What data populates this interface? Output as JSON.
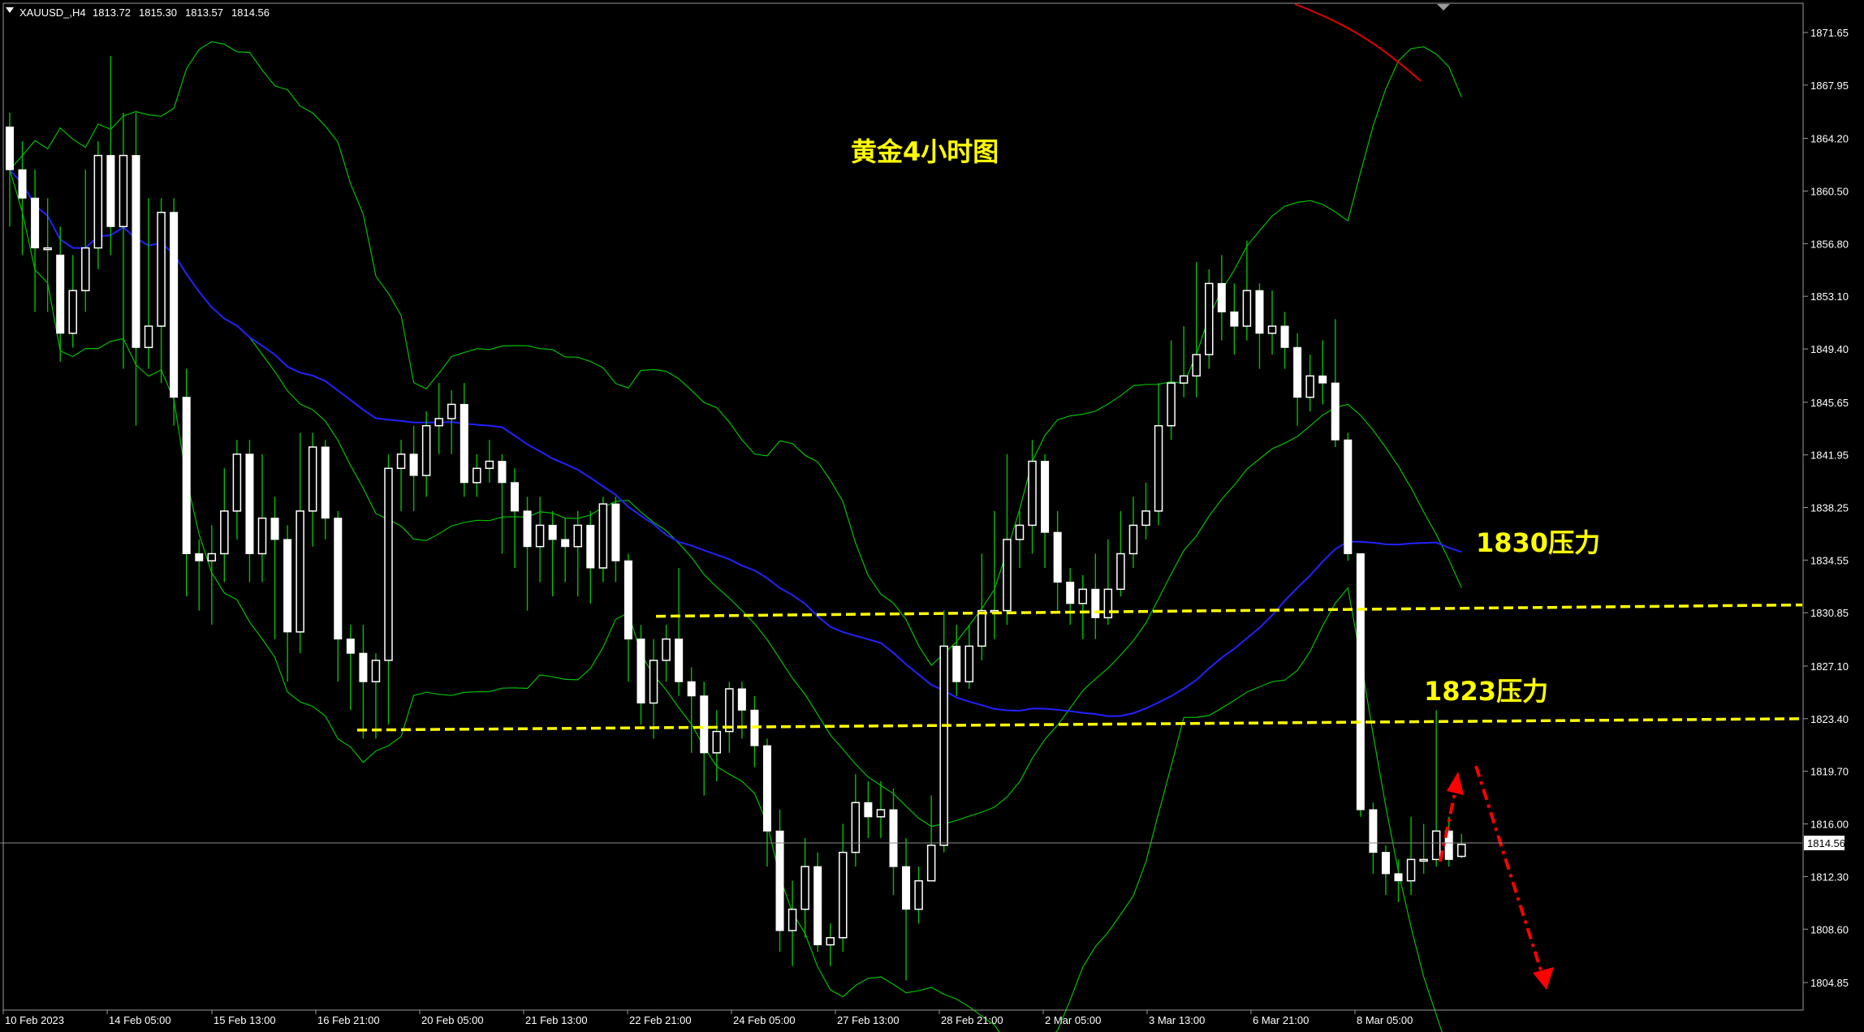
{
  "header": {
    "symbol": "XAUUSD_,H4",
    "open": "1813.72",
    "high": "1815.30",
    "low": "1813.57",
    "close": "1814.56"
  },
  "annotations": {
    "title": "黄金4小时图",
    "resistance_1830": "1830压力",
    "resistance_1823": "1823压力"
  },
  "colors": {
    "background": "#000000",
    "bull_candle": "#ffffff",
    "wick": "#00c000",
    "bollinger": "#00c000",
    "ma_blue": "#2222ff",
    "ma_red": "#e00000",
    "dashed_level": "#ffff00",
    "arrow": "#ff0000",
    "axis_text": "#ffffff"
  },
  "chart_data": {
    "type": "candlestick",
    "title": "黄金4小时图",
    "ylim": [
      1802.0,
      1874.0
    ],
    "y_ticks": [
      "1871.65",
      "1867.95",
      "1864.20",
      "1860.50",
      "1856.80",
      "1853.10",
      "1849.40",
      "1845.65",
      "1841.95",
      "1838.25",
      "1834.55",
      "1830.85",
      "1827.10",
      "1823.40",
      "1819.70",
      "1816.00",
      "1812.30",
      "1808.60",
      "1804.85"
    ],
    "x_ticks": [
      "10 Feb 2023",
      "14 Feb 05:00",
      "15 Feb 13:00",
      "16 Feb 21:00",
      "20 Feb 05:00",
      "21 Feb 13:00",
      "22 Feb 21:00",
      "24 Feb 05:00",
      "27 Feb 13:00",
      "28 Feb 21:00",
      "2 Mar 05:00",
      "3 Mar 13:00",
      "6 Mar 21:00",
      "8 Mar 05:00"
    ],
    "current_price": "1814.56",
    "levels": [
      {
        "label": "1830压力",
        "from": 1830.6,
        "to": 1831.4
      },
      {
        "label": "1823压力",
        "from": 1822.6,
        "to": 1823.4
      }
    ],
    "candles": [
      [
        1865.0,
        1862.0,
        1866.0,
        1858.0
      ],
      [
        1862.0,
        1860.0,
        1864.0,
        1856.0
      ],
      [
        1860.0,
        1856.5,
        1862.0,
        1852.0
      ],
      [
        1856.5,
        1856.5,
        1860.0,
        1852.0
      ],
      [
        1856.0,
        1850.5,
        1858.0,
        1848.5
      ],
      [
        1850.5,
        1853.5,
        1856.0,
        1849.5
      ],
      [
        1853.5,
        1856.5,
        1862.0,
        1852.0
      ],
      [
        1856.5,
        1863.0,
        1864.0,
        1855.0
      ],
      [
        1863.0,
        1858.0,
        1870.0,
        1856.0
      ],
      [
        1858.0,
        1863.0,
        1866.0,
        1848.0
      ],
      [
        1863.0,
        1849.5,
        1866.0,
        1844.0
      ],
      [
        1849.5,
        1851.0,
        1860.0,
        1848.0
      ],
      [
        1851.0,
        1859.0,
        1860.0,
        1847.0
      ],
      [
        1859.0,
        1846.0,
        1860.0,
        1844.0
      ],
      [
        1846.0,
        1835.0,
        1848.0,
        1832.0
      ],
      [
        1835.0,
        1834.5,
        1836.0,
        1831.0
      ],
      [
        1834.5,
        1835.0,
        1837.0,
        1830.0
      ],
      [
        1835.0,
        1838.0,
        1841.0,
        1833.0
      ],
      [
        1838.0,
        1842.0,
        1843.0,
        1836.0
      ],
      [
        1842.0,
        1835.0,
        1843.0,
        1833.0
      ],
      [
        1835.0,
        1837.5,
        1842.0,
        1833.0
      ],
      [
        1837.5,
        1836.0,
        1839.0,
        1829.0
      ],
      [
        1836.0,
        1829.5,
        1837.0,
        1826.0
      ],
      [
        1829.5,
        1838.0,
        1843.5,
        1828.0
      ],
      [
        1838.0,
        1842.5,
        1843.5,
        1835.5
      ],
      [
        1842.5,
        1837.5,
        1843.0,
        1836.0
      ],
      [
        1837.5,
        1829.0,
        1838.0,
        1826.0
      ],
      [
        1829.0,
        1828.0,
        1830.0,
        1824.0
      ],
      [
        1828.0,
        1826.0,
        1830.0,
        1822.0
      ],
      [
        1826.0,
        1827.5,
        1828.0,
        1822.0
      ],
      [
        1827.5,
        1841.0,
        1842.0,
        1823.0
      ],
      [
        1841.0,
        1842.0,
        1843.0,
        1838.0
      ],
      [
        1842.0,
        1840.5,
        1844.0,
        1838.0
      ],
      [
        1840.5,
        1844.0,
        1845.0,
        1839.0
      ],
      [
        1844.0,
        1844.5,
        1847.0,
        1842.0
      ],
      [
        1844.5,
        1845.5,
        1846.5,
        1842.0
      ],
      [
        1845.5,
        1840.0,
        1847.0,
        1839.0
      ],
      [
        1840.0,
        1841.0,
        1842.0,
        1839.0
      ],
      [
        1841.0,
        1841.5,
        1843.0,
        1840.0
      ],
      [
        1841.5,
        1840.0,
        1842.0,
        1835.0
      ],
      [
        1840.0,
        1838.0,
        1841.0,
        1834.0
      ],
      [
        1838.0,
        1835.5,
        1839.0,
        1831.0
      ],
      [
        1835.5,
        1837.0,
        1839.0,
        1833.0
      ],
      [
        1837.0,
        1836.0,
        1838.0,
        1832.0
      ],
      [
        1836.0,
        1835.5,
        1837.5,
        1833.0
      ],
      [
        1835.5,
        1837.0,
        1838.0,
        1832.0
      ],
      [
        1837.0,
        1834.0,
        1838.0,
        1831.5
      ],
      [
        1834.0,
        1838.5,
        1839.0,
        1833.0
      ],
      [
        1838.5,
        1834.5,
        1839.0,
        1833.0
      ],
      [
        1834.5,
        1829.0,
        1835.0,
        1826.0
      ],
      [
        1829.0,
        1824.5,
        1830.0,
        1823.0
      ],
      [
        1824.5,
        1827.5,
        1829.0,
        1822.0
      ],
      [
        1827.5,
        1829.0,
        1830.0,
        1826.0
      ],
      [
        1829.0,
        1826.0,
        1834.0,
        1825.0
      ],
      [
        1826.0,
        1825.0,
        1827.0,
        1821.0
      ],
      [
        1825.0,
        1821.0,
        1826.0,
        1818.0
      ],
      [
        1821.0,
        1822.5,
        1824.0,
        1819.0
      ],
      [
        1822.5,
        1825.5,
        1826.0,
        1821.0
      ],
      [
        1825.5,
        1824.0,
        1826.0,
        1822.0
      ],
      [
        1824.0,
        1821.5,
        1825.0,
        1820.0
      ],
      [
        1821.5,
        1815.5,
        1822.0,
        1813.0
      ],
      [
        1815.5,
        1808.5,
        1817.0,
        1807.0
      ],
      [
        1808.5,
        1810.0,
        1812.0,
        1806.0
      ],
      [
        1810.0,
        1813.0,
        1815.0,
        1808.0
      ],
      [
        1813.0,
        1807.5,
        1814.0,
        1807.0
      ],
      [
        1807.5,
        1808.0,
        1809.0,
        1806.0
      ],
      [
        1808.0,
        1814.0,
        1816.0,
        1807.0
      ],
      [
        1814.0,
        1817.5,
        1819.5,
        1813.0
      ],
      [
        1817.5,
        1816.5,
        1819.0,
        1815.0
      ],
      [
        1816.5,
        1817.0,
        1819.0,
        1815.0
      ],
      [
        1817.0,
        1813.0,
        1818.5,
        1811.0
      ],
      [
        1813.0,
        1810.0,
        1815.0,
        1805.0
      ],
      [
        1810.0,
        1812.0,
        1813.0,
        1809.0
      ],
      [
        1812.0,
        1814.5,
        1818.0,
        1813.0
      ],
      [
        1814.5,
        1828.5,
        1831.0,
        1814.0
      ],
      [
        1828.5,
        1826.0,
        1830.0,
        1825.0
      ],
      [
        1826.0,
        1828.5,
        1830.0,
        1825.5
      ],
      [
        1828.5,
        1831.0,
        1835.0,
        1827.5
      ],
      [
        1831.0,
        1831.0,
        1838.0,
        1829.0
      ],
      [
        1831.0,
        1836.0,
        1842.0,
        1830.0
      ],
      [
        1836.0,
        1837.0,
        1838.0,
        1834.0
      ],
      [
        1837.0,
        1841.5,
        1843.0,
        1835.0
      ],
      [
        1841.5,
        1836.5,
        1842.0,
        1834.0
      ],
      [
        1836.5,
        1833.0,
        1838.0,
        1831.0
      ],
      [
        1833.0,
        1831.5,
        1834.0,
        1830.0
      ],
      [
        1831.5,
        1832.5,
        1833.5,
        1829.0
      ],
      [
        1832.5,
        1830.5,
        1835.0,
        1829.0
      ],
      [
        1830.5,
        1832.5,
        1836.0,
        1830.0
      ],
      [
        1832.5,
        1835.0,
        1838.0,
        1832.0
      ],
      [
        1835.0,
        1837.0,
        1839.0,
        1834.0
      ],
      [
        1837.0,
        1838.0,
        1840.0,
        1836.0
      ],
      [
        1838.0,
        1844.0,
        1847.0,
        1837.0
      ],
      [
        1844.0,
        1847.0,
        1850.0,
        1843.0
      ],
      [
        1847.0,
        1847.5,
        1851.0,
        1846.0
      ],
      [
        1847.5,
        1849.0,
        1855.5,
        1846.0
      ],
      [
        1849.0,
        1854.0,
        1855.0,
        1848.0
      ],
      [
        1854.0,
        1852.0,
        1856.0,
        1850.0
      ],
      [
        1852.0,
        1851.0,
        1854.0,
        1849.0
      ],
      [
        1851.0,
        1853.5,
        1857.0,
        1850.0
      ],
      [
        1853.5,
        1850.5,
        1854.0,
        1848.0
      ],
      [
        1850.5,
        1851.0,
        1853.5,
        1849.0
      ],
      [
        1851.0,
        1849.5,
        1852.0,
        1848.0
      ],
      [
        1849.5,
        1846.0,
        1850.5,
        1844.0
      ],
      [
        1846.0,
        1847.5,
        1849.0,
        1845.0
      ],
      [
        1847.5,
        1847.0,
        1850.0,
        1845.5
      ],
      [
        1847.0,
        1843.0,
        1851.5,
        1842.5
      ],
      [
        1843.0,
        1835.0,
        1843.5,
        1834.5
      ],
      [
        1835.0,
        1817.0,
        1835.0,
        1816.5
      ],
      [
        1817.0,
        1814.0,
        1817.5,
        1812.5
      ],
      [
        1814.0,
        1812.5,
        1814.5,
        1811.0
      ],
      [
        1812.5,
        1812.0,
        1813.5,
        1810.5
      ],
      [
        1812.0,
        1813.5,
        1816.5,
        1811.0
      ],
      [
        1813.5,
        1813.5,
        1816.0,
        1812.5
      ],
      [
        1813.5,
        1815.5,
        1824.0,
        1813.0
      ],
      [
        1815.5,
        1813.5,
        1816.5,
        1813.0
      ],
      [
        1813.72,
        1814.56,
        1815.3,
        1813.57
      ]
    ]
  }
}
